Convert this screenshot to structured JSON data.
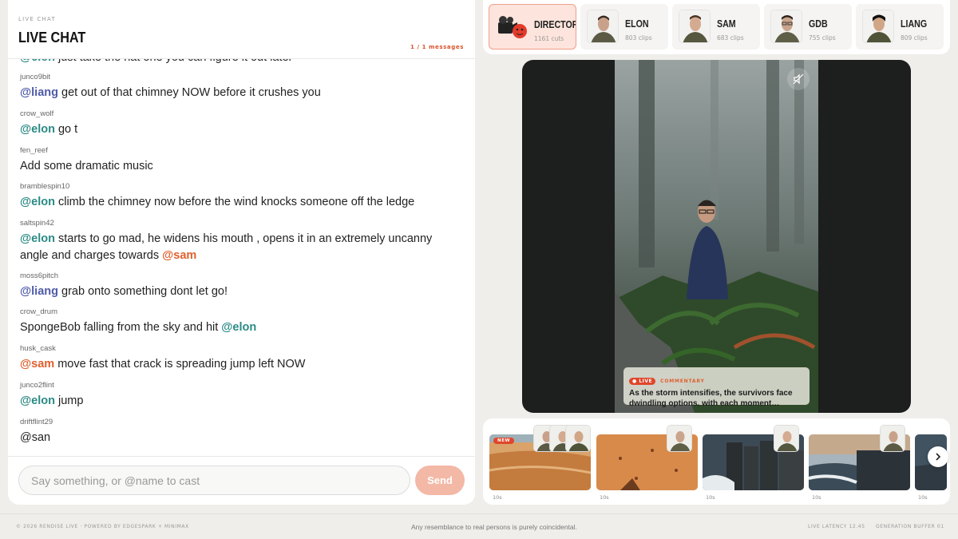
{
  "chat": {
    "kicker": "LIVE CHAT",
    "title": "LIVE CHAT",
    "count": "1 / 1 messages",
    "partial_message": "@elon just take the hat one you can figure it out later",
    "messages": [
      {
        "user": "junco9bit",
        "mention": "@liang",
        "mention_color": "#4f5ba8",
        "text": " get out of that chimney NOW before it crushes you"
      },
      {
        "user": "crow_wolf",
        "mention": "@elon",
        "mention_color": "#2a8a84",
        "text": " go t"
      },
      {
        "user": "fen_reef",
        "mention": "",
        "text": "Add some dramatic music"
      },
      {
        "user": "bramblespin10",
        "mention": "@elon",
        "mention_color": "#2a8a84",
        "text": " climb the chimney now before the wind knocks someone off the ledge"
      },
      {
        "user": "saltspin42",
        "mention": "@elon",
        "mention_color": "#2a8a84",
        "text": " starts to go mad, he widens his mouth , opens it in an extremely uncanny angle and charges towards ",
        "trailing_mention": "@sam",
        "trailing_color": "#e0602f"
      },
      {
        "user": "moss6pitch",
        "mention": "@liang",
        "mention_color": "#4f5ba8",
        "text": " grab onto something dont let go!"
      },
      {
        "user": "crow_drum",
        "mention": "",
        "text": "SpongeBob falling from the sky and hit ",
        "trailing_mention": "@elon",
        "trailing_color": "#2a8a84"
      },
      {
        "user": "husk_cask",
        "mention": "@sam",
        "mention_color": "#e0602f",
        "text": " move fast that crack is spreading jump left NOW"
      },
      {
        "user": "junco2flint",
        "mention": "@elon",
        "mention_color": "#2a8a84",
        "text": " jump"
      },
      {
        "user": "driftflint29",
        "mention": "",
        "text": "@san"
      }
    ],
    "input_placeholder": "Say something, or @name to cast",
    "send_label": "Send"
  },
  "cast": [
    {
      "name": "DIRECTOR",
      "clips": "1161 cuts",
      "active": true
    },
    {
      "name": "ELON",
      "clips": "803 clips",
      "active": false
    },
    {
      "name": "SAM",
      "clips": "683 clips",
      "active": false
    },
    {
      "name": "GDB",
      "clips": "755 clips",
      "active": false
    },
    {
      "name": "LIANG",
      "clips": "809 clips",
      "active": false
    }
  ],
  "video": {
    "live_label": "LIVE",
    "caption_kind": "COMMENTARY",
    "caption_text": "As the storm intensifies, the survivors face dwindling options, with each moment…"
  },
  "timeline": {
    "clips": [
      {
        "scene": "desert",
        "duration": "10s",
        "badge": "NEW"
      },
      {
        "scene": "desert-close",
        "duration": "10s",
        "badge": ""
      },
      {
        "scene": "coast-rocks",
        "duration": "10s",
        "badge": ""
      },
      {
        "scene": "cliffs",
        "duration": "10s",
        "badge": ""
      },
      {
        "scene": "coast",
        "duration": "10s",
        "badge": ""
      }
    ]
  },
  "footer": {
    "left": "© 2026 RENDISE LIVE · POWERED BY EDGESPARK + MINIMAX",
    "center": "Any resemblance to real persons is purely coincidental.",
    "latency": "LIVE LATENCY 12.45",
    "buffer": "GENERATION BUFFER 01"
  },
  "colors": {
    "accent": "#e0602f",
    "elon": "#2a8a84",
    "liang": "#4f5ba8",
    "sam": "#e0602f",
    "send": "#f3b8a6"
  }
}
